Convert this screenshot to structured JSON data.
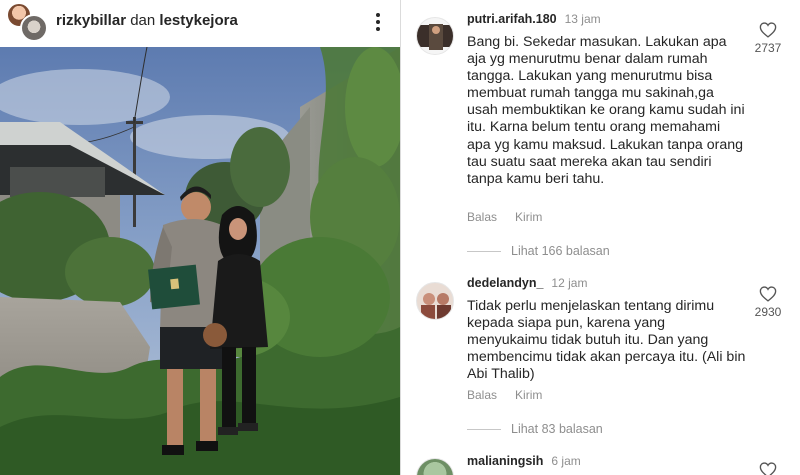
{
  "post": {
    "owner_primary": "rizkybillar",
    "conjunction": "dan",
    "owner_secondary": "lestykejora",
    "more_icon": "more-vertical-icon",
    "book_lettering": "❀"
  },
  "comments": [
    {
      "username": "putri.arifah.180",
      "time": "13 jam",
      "text": "Bang bi. Sekedar masukan. Lakukan apa aja yg menurutmu benar dalam rumah tangga. Lakukan yang menurutmu bisa membuat rumah tangga mu sakinah,ga usah membuktikan ke orang kamu sudah ini itu. Karna belum tentu orang memahami apa yg kamu maksud. Lakukan tanpa orang tau suatu saat mereka akan tau sendiri tanpa kamu beri tahu.",
      "reply_label": "Balas",
      "send_label": "Kirim",
      "likes": "2737",
      "view_replies": "Lihat 166 balasan"
    },
    {
      "username": "dedelandyn_",
      "time": "12 jam",
      "text": "Tidak perlu menjelaskan tentang dirimu kepada siapa pun, karena yang menyukaimu tidak butuh itu. Dan yang membencimu tidak akan percaya itu. (Ali bin Abi Thalib)",
      "reply_label": "Balas",
      "send_label": "Kirim",
      "likes": "2930",
      "view_replies": "Lihat 83 balasan"
    },
    {
      "username": "malianingsih",
      "time": "6 jam",
      "text": "",
      "likes": ""
    }
  ],
  "colors": {
    "text": "#262626",
    "muted": "#8e8e8e",
    "divider": "#dbdbdb",
    "book_green": "#1f4d3a"
  }
}
